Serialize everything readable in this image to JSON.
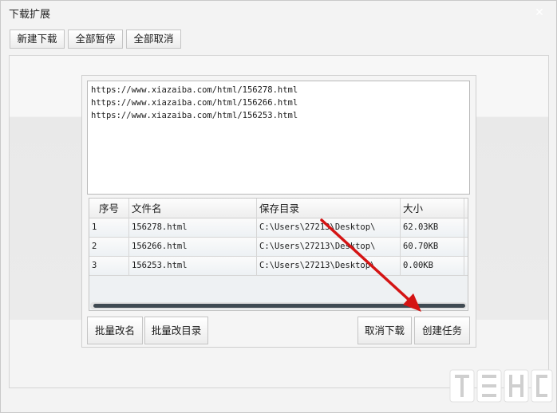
{
  "window": {
    "title": "下载扩展"
  },
  "toolbar": {
    "new_label": "新建下载",
    "pause_all_label": "全部暂停",
    "cancel_all_label": "全部取消"
  },
  "url_list": [
    "https://www.xiazaiba.com/html/156278.html",
    "https://www.xiazaiba.com/html/156266.html",
    "https://www.xiazaiba.com/html/156253.html"
  ],
  "table": {
    "columns": [
      "序号",
      "文件名",
      "保存目录",
      "大小"
    ],
    "rows": [
      [
        "1",
        "156278.html",
        "C:\\Users\\27213\\Desktop\\",
        "62.03KB"
      ],
      [
        "2",
        "156266.html",
        "C:\\Users\\27213\\Desktop\\",
        "60.70KB"
      ],
      [
        "3",
        "156253.html",
        "C:\\Users\\27213\\Desktop\\",
        "0.00KB"
      ]
    ]
  },
  "actions": {
    "batch_rename_label": "批量改名",
    "batch_dir_label": "批量改目录",
    "cancel_download_label": "取消下载",
    "create_task_label": "创建任务"
  },
  "icons": {
    "close": "close-icon",
    "annotation": "red-arrow-icon",
    "watermark": "logo-icon"
  },
  "colors": {
    "arrow": "#d41414",
    "scroll_thumb": "#3f4a52"
  }
}
